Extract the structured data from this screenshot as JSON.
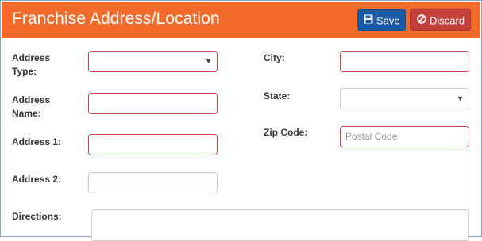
{
  "header": {
    "title": "Franchise Address/Location",
    "save_label": "Save",
    "discard_label": "Discard"
  },
  "fields": {
    "address_type": {
      "label_line1": "Address",
      "label_line2": "Type:",
      "value": ""
    },
    "address_name": {
      "label_line1": "Address",
      "label_line2": "Name:",
      "value": ""
    },
    "address1": {
      "label": "Address 1:",
      "value": ""
    },
    "address2": {
      "label": "Address 2:",
      "value": ""
    },
    "directions": {
      "label": "Directions:",
      "value": ""
    },
    "city": {
      "label": "City:",
      "value": ""
    },
    "state": {
      "label": "State:",
      "value": ""
    },
    "zip": {
      "label": "Zip Code:",
      "placeholder": "Postal Code",
      "value": ""
    }
  },
  "icons": {
    "save": "floppy-disk-icon",
    "discard": "ban-icon",
    "dropdown": "caret-down-icon"
  },
  "colors": {
    "header_bg": "#f26b2b",
    "save_bg": "#1c5aa6",
    "discard_bg": "#c2413c",
    "invalid_border": "#c9454a"
  }
}
